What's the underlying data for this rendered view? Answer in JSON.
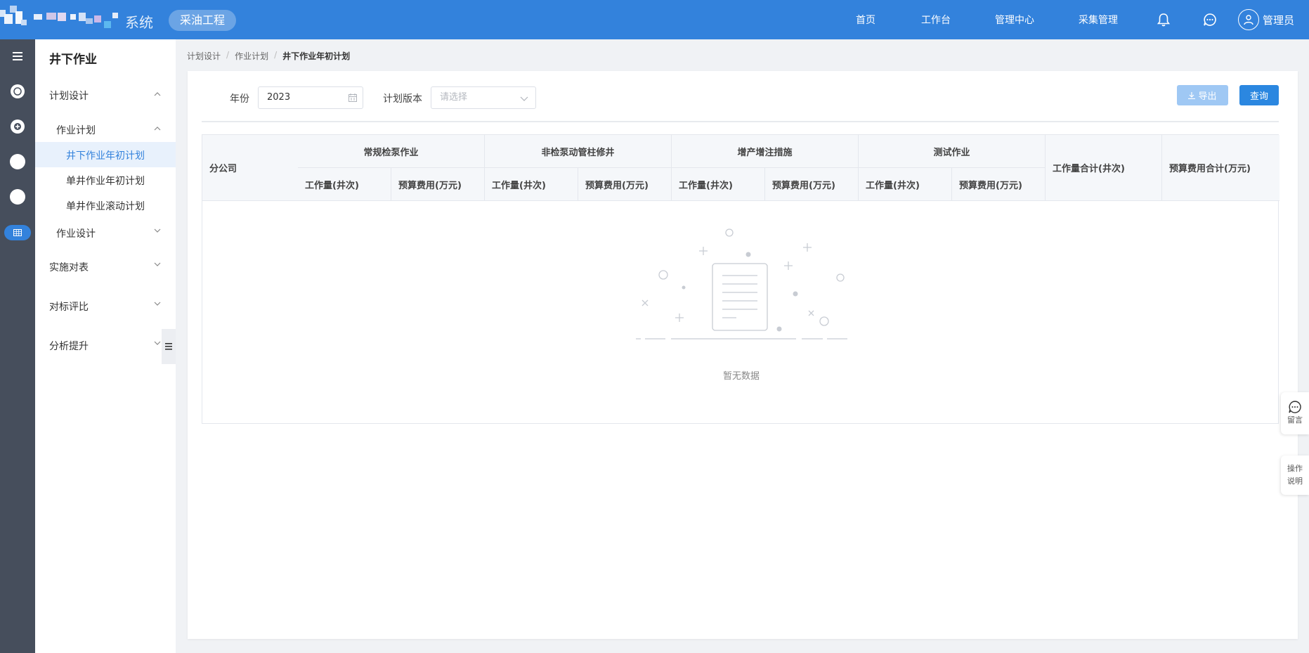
{
  "header": {
    "logo_tail": "系统",
    "app_name": "采油工程",
    "nav": [
      "首页",
      "工作台",
      "管理中心",
      "采集管理"
    ],
    "user_name": "管理员",
    "icons": [
      "bell-icon",
      "chat-icon",
      "user-icon"
    ]
  },
  "rail": {
    "icons": [
      "circle-icon",
      "plus-circle-icon",
      "circle-icon",
      "circle-icon",
      "grid-icon"
    ]
  },
  "sidemenu": {
    "title": "井下作业",
    "groups": [
      {
        "label": "计划设计",
        "expanded": true
      },
      {
        "label": "作业计划",
        "expanded": true
      },
      {
        "label": "井下作业年初计划",
        "active": true
      },
      {
        "label": "单井作业年初计划"
      },
      {
        "label": "单井作业滚动计划"
      },
      {
        "label": "作业设计",
        "expanded": false
      },
      {
        "label": "实施对表",
        "expanded": false
      },
      {
        "label": "对标评比",
        "expanded": false
      },
      {
        "label": "分析提升",
        "expanded": false
      }
    ]
  },
  "breadcrumb": [
    "计划设计",
    "作业计划",
    "井下作业年初计划"
  ],
  "filters": {
    "year_label": "年份",
    "year_value": "2023",
    "version_label": "计划版本",
    "version_placeholder": "请选择"
  },
  "buttons": {
    "export": "导出",
    "query": "查询"
  },
  "table": {
    "branch": "分公司",
    "groups": [
      "常规检泵作业",
      "非检泵动管柱修井",
      "增产增注措施",
      "测试作业"
    ],
    "sub_workload": "工作量(井次)",
    "sub_budget": "预算费用(万元)",
    "total_workload": "工作量合计(井次)",
    "total_budget": "预算费用合计(万元)",
    "empty_text": "暂无数据"
  },
  "float_tabs": {
    "message": "留言",
    "help_line1": "操作",
    "help_line2": "说明"
  },
  "colors": {
    "primary": "#3382dc",
    "rail": "#464e5c",
    "active_bg": "#e8f1fc"
  }
}
